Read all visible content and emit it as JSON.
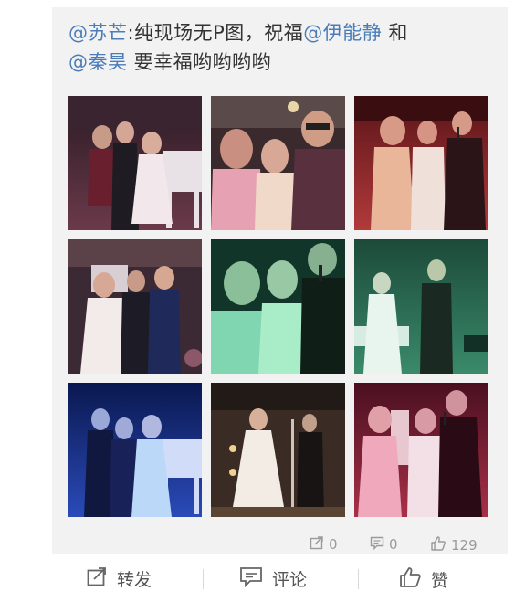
{
  "post": {
    "mention_1": "@苏芒",
    "text_1": ":纯现场无P图，祝福",
    "mention_2": "@伊能静",
    "text_2": " 和",
    "mention_3": "@秦昊",
    "text_3": " 要幸福哟哟哟哟"
  },
  "photos": [
    {
      "scene": "purple-stage-piano"
    },
    {
      "scene": "pink-closeup-group"
    },
    {
      "scene": "red-stage-mic"
    },
    {
      "scene": "pink-stage-group"
    },
    {
      "scene": "green-closeup-mic"
    },
    {
      "scene": "green-stage-piano"
    },
    {
      "scene": "blue-stage-piano"
    },
    {
      "scene": "warm-stage-mic"
    },
    {
      "scene": "red-stage-duet"
    }
  ],
  "counts": {
    "repost": "0",
    "comment": "0",
    "like": "129"
  },
  "actions": {
    "repost_label": "转发",
    "comment_label": "评论",
    "like_label": "赞"
  },
  "colors": {
    "mention": "#4a7db8",
    "text": "#333333",
    "card_bg": "#f2f2f2",
    "muted": "#9a9a9a"
  }
}
